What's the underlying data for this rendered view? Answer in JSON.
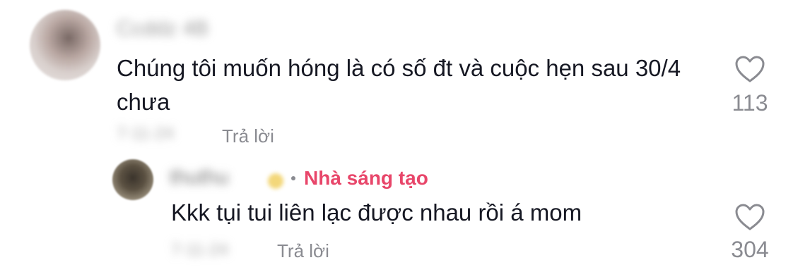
{
  "comment": {
    "username": "Ccddz 4B",
    "text": "Chúng tôi muốn hóng là có số đt và cuộc hẹn sau 30/4 chưa",
    "date": "7-11-24",
    "reply_label": "Trả lời",
    "like_count": "113"
  },
  "reply": {
    "username": "thuthu",
    "creator_label": "Nhà sáng tạo",
    "text": "Kkk tụi tui liên lạc được nhau rồi á mom",
    "date": "7-11-24",
    "reply_label": "Trả lời",
    "like_count": "304"
  },
  "colors": {
    "creator_accent": "#e8466a",
    "secondary_text": "#8a8b91",
    "primary_text": "#161823"
  },
  "icons": {
    "like": "heart-outline-icon"
  }
}
